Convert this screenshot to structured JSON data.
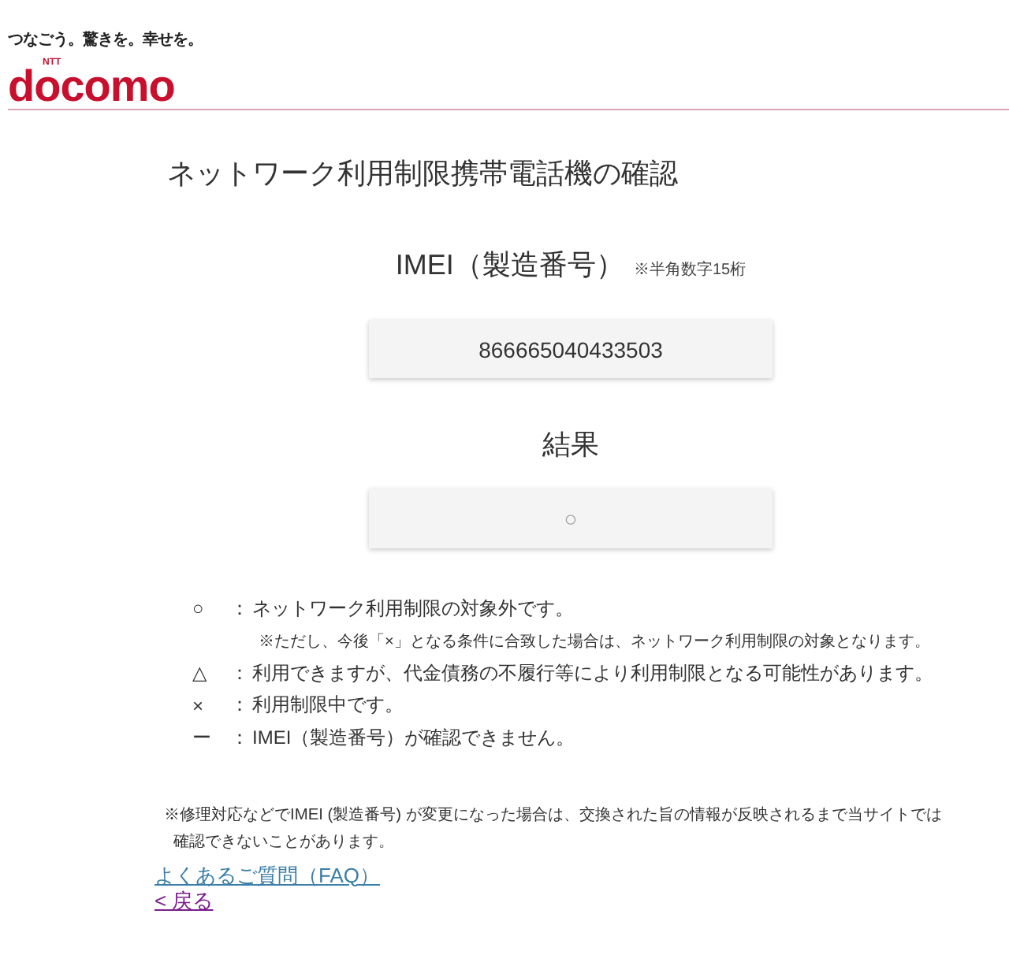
{
  "header": {
    "tagline": "つなごう。驚きを。幸せを。",
    "logo_super": "NTT",
    "logo": "docomo"
  },
  "title": "ネットワーク利用制限携帯電話機の確認",
  "imei": {
    "label": "IMEI（製造番号）",
    "note": "※半角数字15桁",
    "value": "866665040433503"
  },
  "result": {
    "label": "結果",
    "value": "○"
  },
  "legend": [
    {
      "symbol": "○",
      "separator": "：",
      "text": "ネットワーク利用制限の対象外です。",
      "note": "※ただし、今後「×」となる条件に合致した場合は、ネットワーク利用制限の対象となります。"
    },
    {
      "symbol": "△",
      "separator": "：",
      "text": "利用できますが、代金債務の不履行等により利用制限となる可能性があります。"
    },
    {
      "symbol": "×",
      "separator": "：",
      "text": "利用制限中です。"
    },
    {
      "symbol": "ー",
      "separator": "：",
      "text": "IMEI（製造番号）が確認できません。"
    }
  ],
  "footnote": "※修理対応などでIMEI (製造番号) が変更になった場合は、交換された旨の情報が反映されるまで当サイトでは確認できないことがあります。",
  "links": [
    {
      "label": "よくあるご質問（FAQ）",
      "visited": false
    },
    {
      "label": "< 戻る",
      "visited": true
    }
  ]
}
